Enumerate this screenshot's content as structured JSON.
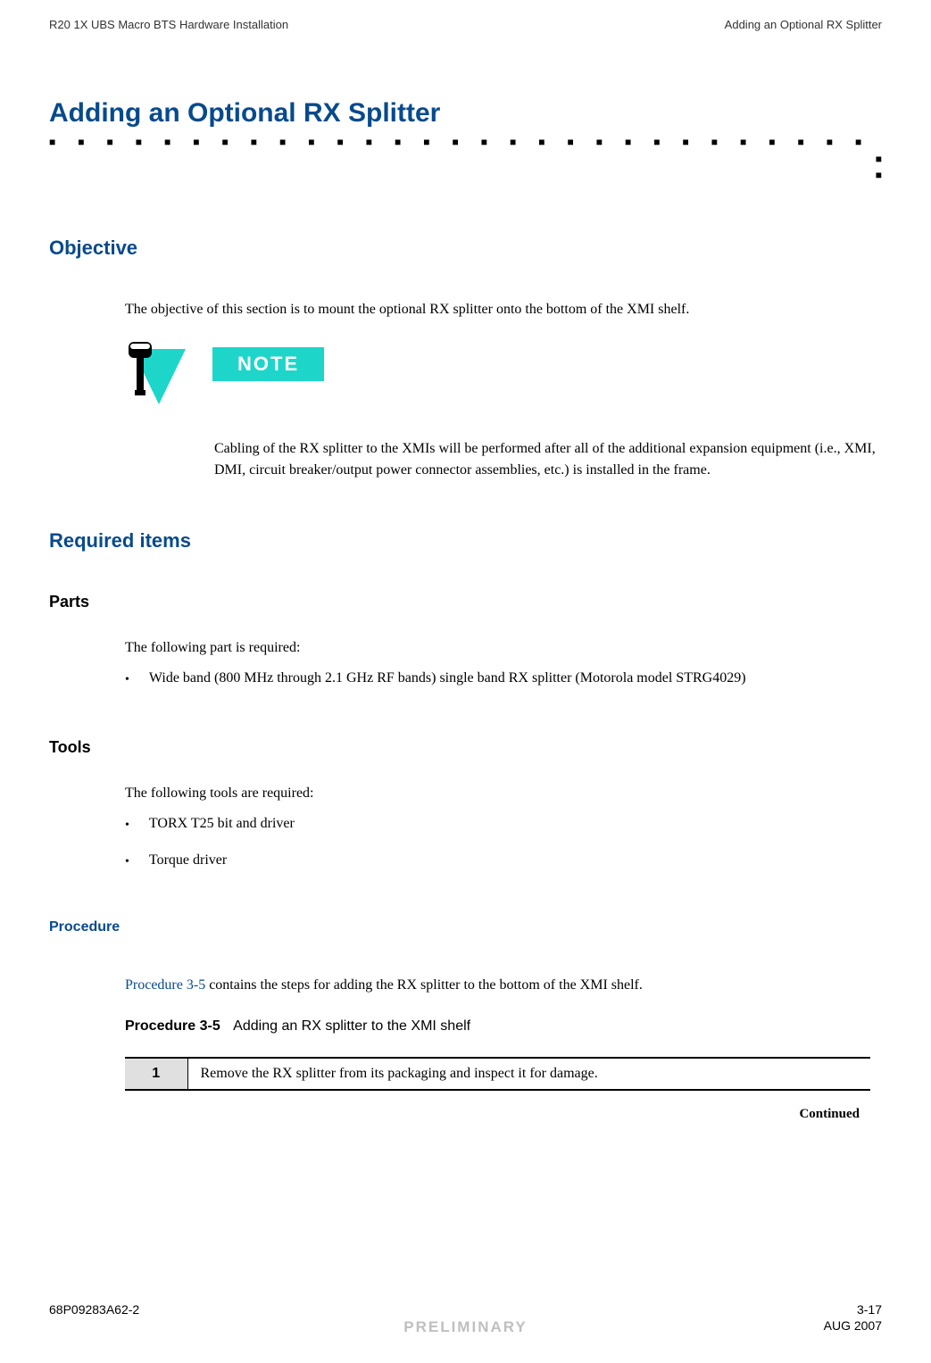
{
  "header": {
    "left": "R20 1X UBS Macro BTS Hardware Installation",
    "right": "Adding an Optional RX Splitter"
  },
  "title": "Adding an Optional RX Splitter",
  "objective": {
    "heading": "Objective",
    "text": "The objective of this section is to mount the optional RX splitter onto the bottom of the XMI shelf."
  },
  "note": {
    "badge": "NOTE",
    "text": "Cabling of the RX splitter to the XMIs will be performed after all of the additional expansion equipment (i.e., XMI, DMI, circuit breaker/output power connector assemblies, etc.)  is installed in the frame."
  },
  "required": {
    "heading": "Required items",
    "parts": {
      "heading": "Parts",
      "intro": "The following part is required:",
      "items": [
        "Wide band (800 MHz through 2.1 GHz RF bands) single band RX splitter (Motorola model STRG4029)"
      ]
    },
    "tools": {
      "heading": "Tools",
      "intro": "The following tools are required:",
      "items": [
        "TORX T25 bit and driver",
        "Torque driver"
      ]
    }
  },
  "procedure": {
    "heading": "Procedure",
    "intro_link": "Procedure 3-5",
    "intro_rest": " contains the steps for adding the RX splitter to the bottom of the XMI shelf.",
    "table_label": "Procedure 3-5",
    "table_caption": "Adding an RX splitter to the XMI shelf",
    "steps": [
      {
        "num": "1",
        "text": "Remove the RX splitter from its packaging and inspect it for damage."
      }
    ],
    "continued": "Continued"
  },
  "footer": {
    "doc_number": "68P09283A62-2",
    "page": "3-17",
    "prelim": "PRELIMINARY",
    "date": "AUG 2007"
  }
}
